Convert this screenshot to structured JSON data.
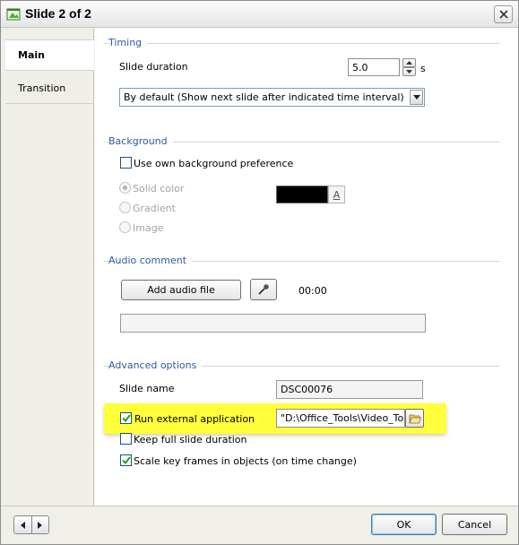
{
  "window": {
    "title": "Slide 2 of 2"
  },
  "sidebar": {
    "items": [
      {
        "label": "Main",
        "active": true
      },
      {
        "label": "Transition",
        "active": false
      }
    ]
  },
  "timing": {
    "group_title": "Timing",
    "slide_duration_label": "Slide duration",
    "slide_duration_value": "5.0",
    "slide_duration_unit": "s",
    "mode_selected": "By default (Show next slide after indicated time interval)"
  },
  "background": {
    "group_title": "Background",
    "own_pref_label": "Use own background preference",
    "own_pref_checked": false,
    "options": [
      "Solid color",
      "Gradient",
      "Image"
    ],
    "selected_option": "Solid color",
    "swatch_color": "#000000",
    "swatch_button_label": "A"
  },
  "audio": {
    "group_title": "Audio comment",
    "add_button_label": "Add audio file",
    "time": "00:00",
    "file_path": ""
  },
  "advanced": {
    "group_title": "Advanced options",
    "slide_name_label": "Slide name",
    "slide_name_value": "DSC00076",
    "run_external_label": "Run external application",
    "run_external_checked": true,
    "external_path": "\"D:\\Office_Tools\\Video_Tools",
    "keep_duration_label": "Keep full slide duration",
    "keep_duration_checked": false,
    "scale_keyframes_label": "Scale key frames in objects (on time change)",
    "scale_keyframes_checked": true,
    "highlight_color": "#ffff3c"
  },
  "footer": {
    "ok_label": "OK",
    "cancel_label": "Cancel"
  }
}
